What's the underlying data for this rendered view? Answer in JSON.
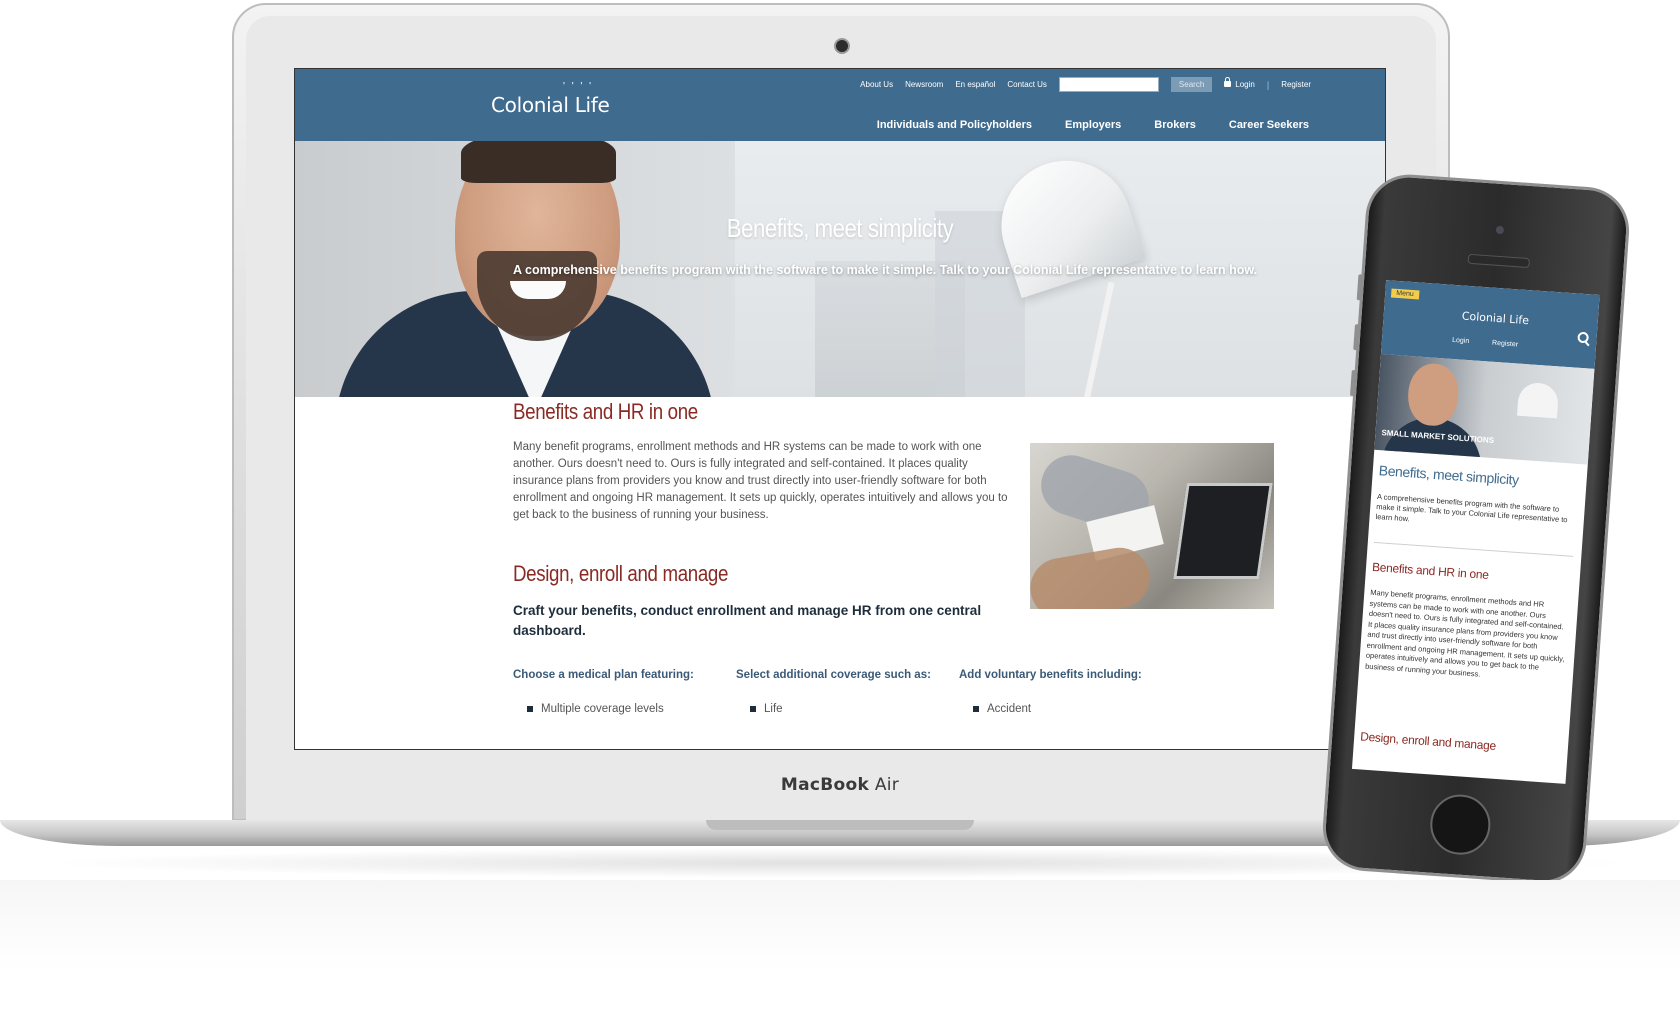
{
  "device": {
    "laptop_label_bold": "MacBook",
    "laptop_label_light": " Air"
  },
  "site": {
    "logo": "Colonial Life",
    "utility_nav": [
      "About Us",
      "Newsroom",
      "En español",
      "Contact Us"
    ],
    "search_placeholder": "",
    "search_button": "Search",
    "login": "Login",
    "register": "Register",
    "main_nav": [
      "Individuals and Policyholders",
      "Employers",
      "Brokers",
      "Career Seekers"
    ]
  },
  "hero": {
    "title": "Benefits, meet simplicity",
    "subtitle": "A comprehensive benefits program with the software to make it simple. Talk to your Colonial Life representative to learn how."
  },
  "content": {
    "section1_title": "Benefits and HR in one",
    "section1_body": "Many benefit programs, enrollment methods and HR systems can be made to work with one another. Ours doesn't need to. Ours is fully integrated and self-contained. It places quality insurance plans from providers you know and trust directly into user-friendly software for both enrollment and ongoing HR management. It sets up quickly, operates intuitively and allows you to get back to the business of running your business.",
    "section2_title": "Design, enroll and manage",
    "section2_lead": "Craft your benefits, conduct enrollment and manage HR from one central dashboard.",
    "columns": [
      {
        "heading": "Choose a medical plan featuring:",
        "first_item": "Multiple coverage levels"
      },
      {
        "heading": "Select additional coverage such as:",
        "first_item": "Life"
      },
      {
        "heading": "Add voluntary benefits including:",
        "first_item": "Accident"
      }
    ]
  },
  "mobile": {
    "menu": "Menu",
    "logo": "Colonial Life",
    "login": "Login",
    "register": "Register",
    "hero_label": "SMALL MARKET SOLUTIONS",
    "title": "Benefits, meet simplicity",
    "intro": "A comprehensive benefits program with the software to make it simple. Talk to your Colonial Life representative to learn how.",
    "section1_title": "Benefits and HR in one",
    "section1_body": "Many benefit programs, enrollment methods and HR systems can be made to work with one another. Ours doesn't need to. Ours is fully integrated and self-contained. It places quality insurance plans from providers you know and trust directly into user-friendly software for both enrollment and ongoing HR management. It sets up quickly, operates intuitively and allows you to get back to the business of running your business.",
    "section2_title": "Design, enroll and manage"
  },
  "colors": {
    "header_blue": "#3f6b8f",
    "heading_red": "#8a2a24",
    "menu_yellow": "#f2cd4c"
  }
}
